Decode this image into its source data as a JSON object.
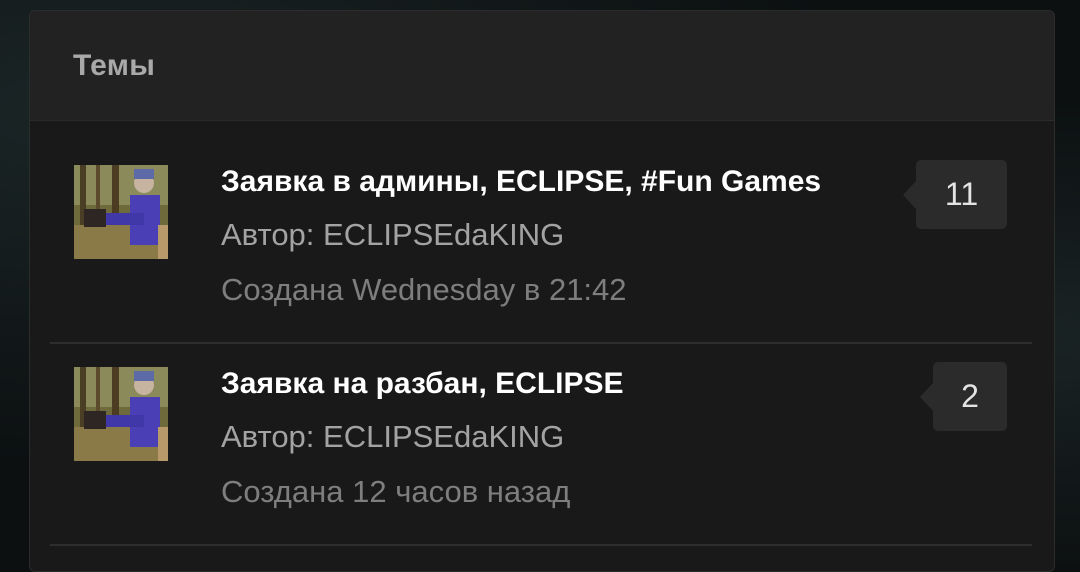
{
  "panel": {
    "title": "Темы"
  },
  "topics": [
    {
      "title": "Заявка в админы, ECLIPSE, #Fun Games",
      "author": "Автор: ECLIPSEdaKING",
      "created": "Создана Wednesday в 21:42",
      "count": "11"
    },
    {
      "title": "Заявка на разбан, ECLIPSE",
      "author": "Автор: ECLIPSEdaKING",
      "created": "Создана 12 часов назад",
      "count": "2"
    }
  ]
}
